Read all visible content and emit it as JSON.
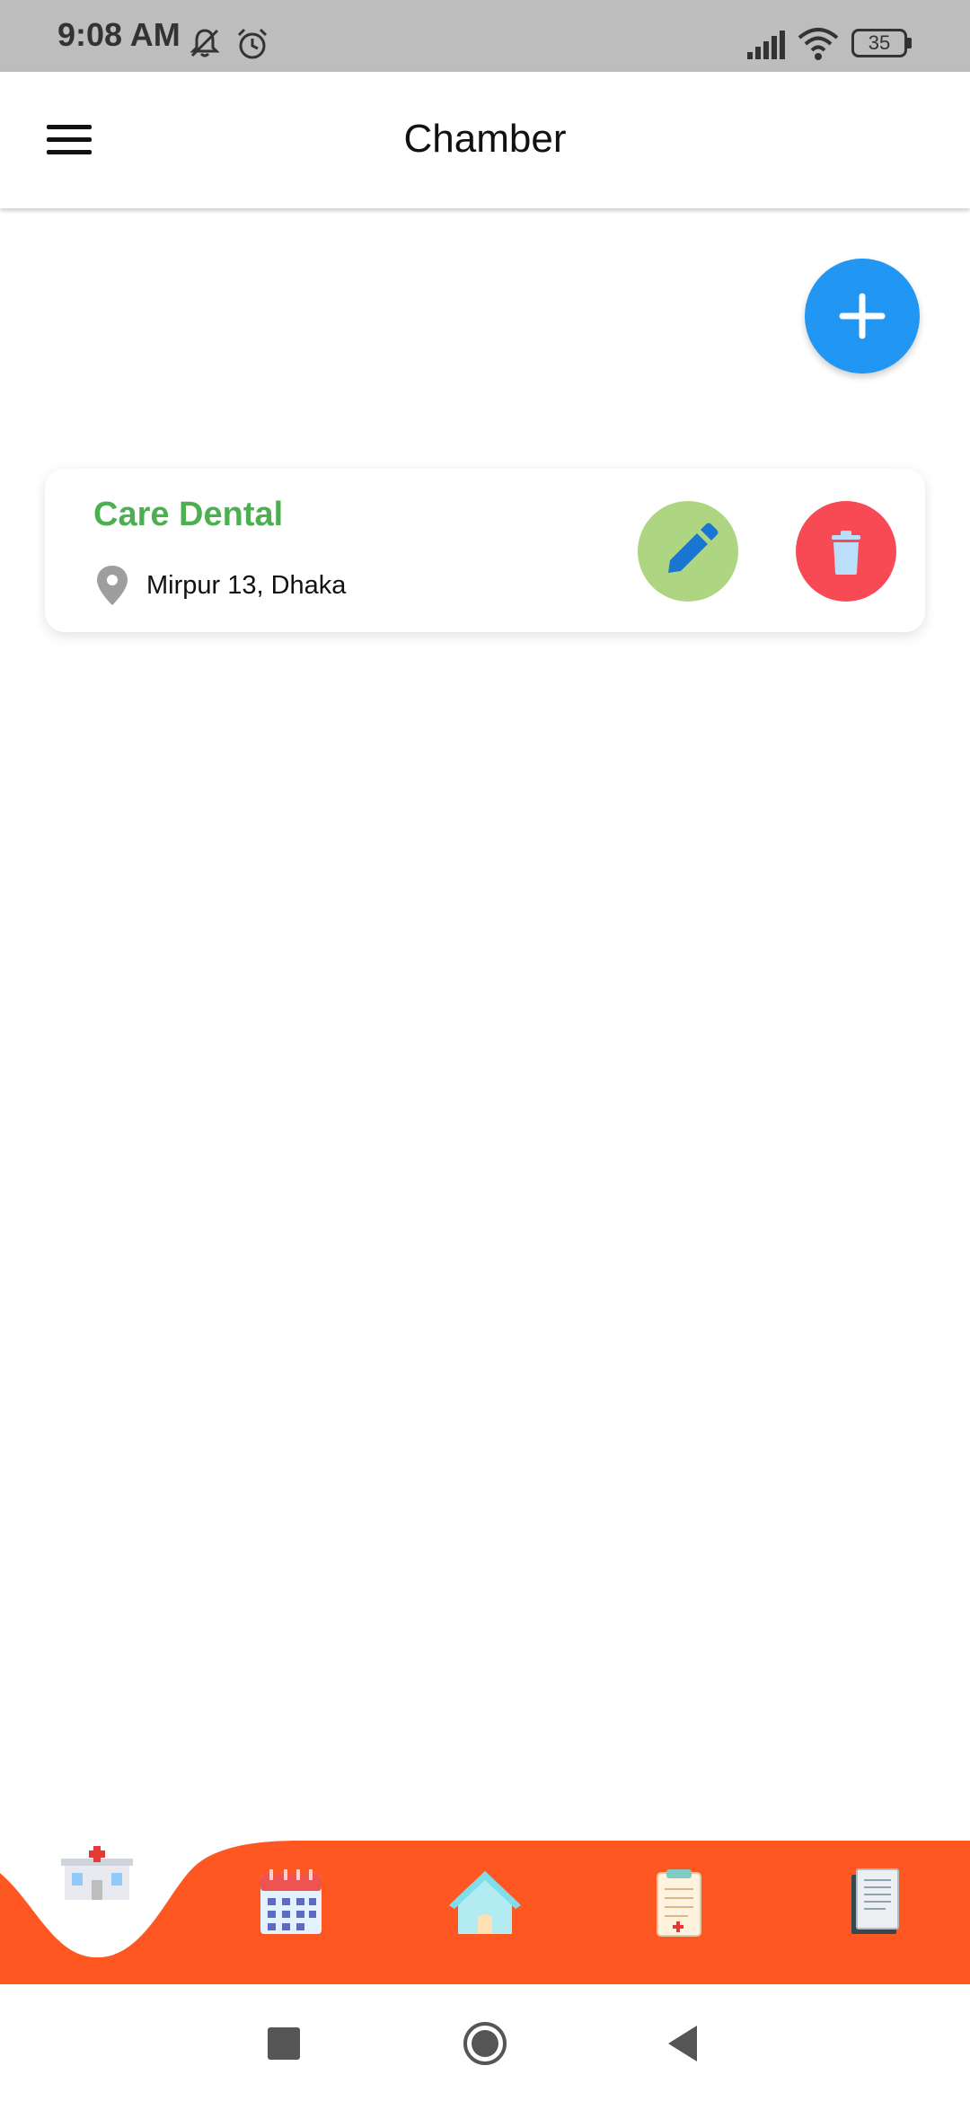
{
  "status_bar": {
    "time": "9:08 AM",
    "battery": "35",
    "icons": [
      "mute-icon",
      "alarm-icon",
      "signal-icon",
      "wifi-icon",
      "battery-icon"
    ]
  },
  "app_bar": {
    "title": "Chamber",
    "menu_icon": "hamburger-menu-icon"
  },
  "add_button": {
    "icon": "plus-icon"
  },
  "chambers": [
    {
      "name": "Care Dental",
      "location": "Mirpur 13, Dhaka"
    }
  ],
  "bottom_nav": {
    "items": [
      {
        "icon": "hospital-icon",
        "selected": true
      },
      {
        "icon": "calendar-icon",
        "selected": false
      },
      {
        "icon": "home-icon",
        "selected": false
      },
      {
        "icon": "clipboard-icon",
        "selected": false
      },
      {
        "icon": "documents-icon",
        "selected": false
      }
    ]
  },
  "colors": {
    "accent": "#2196f3",
    "title_green": "#4caf50",
    "edit_green": "#aed581",
    "delete_red": "#f74a55",
    "nav_orange": "#ff5722"
  }
}
